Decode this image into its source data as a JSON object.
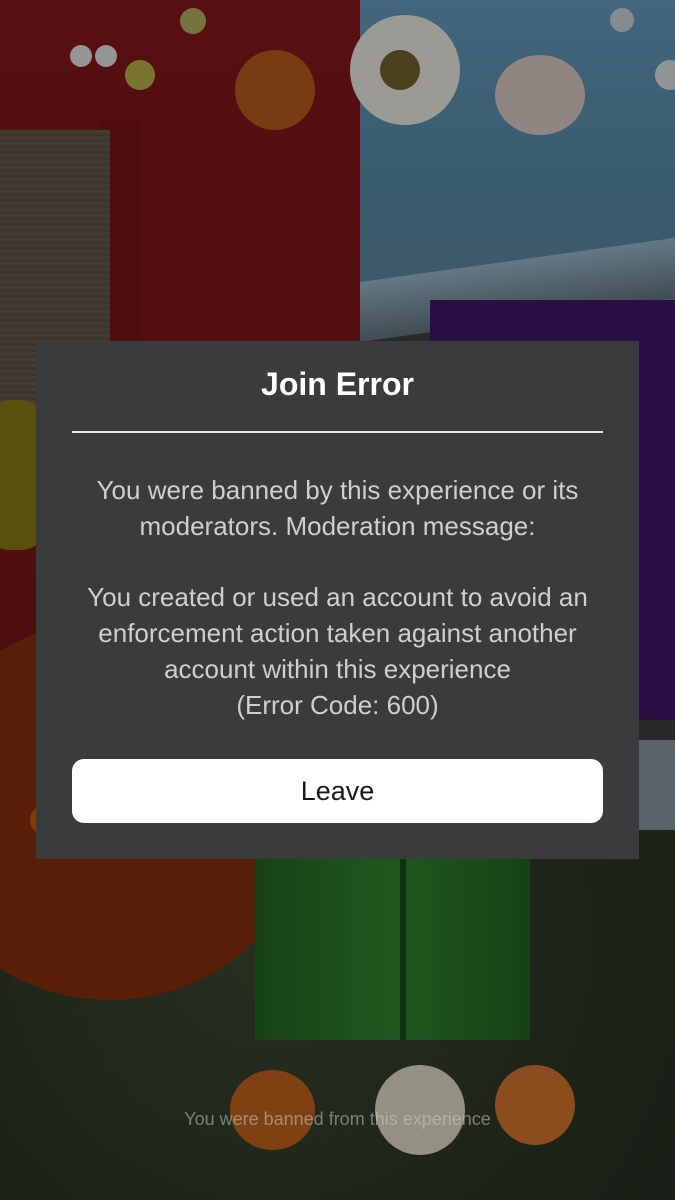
{
  "dialog": {
    "title": "Join Error",
    "message_line_1": "You were banned by this experience or its moderators. Moderation message:",
    "message_line_2": "You created or used an account to avoid an enforcement action taken against another account within this experience",
    "error_code": "(Error Code: 600)",
    "leave_label": "Leave"
  },
  "toast": {
    "text": "You were banned from this experience"
  },
  "colors": {
    "dialog_background": "#393b3d",
    "button_background": "#ffffff",
    "title_text": "#ffffff",
    "body_text": "#cfcfcf"
  }
}
